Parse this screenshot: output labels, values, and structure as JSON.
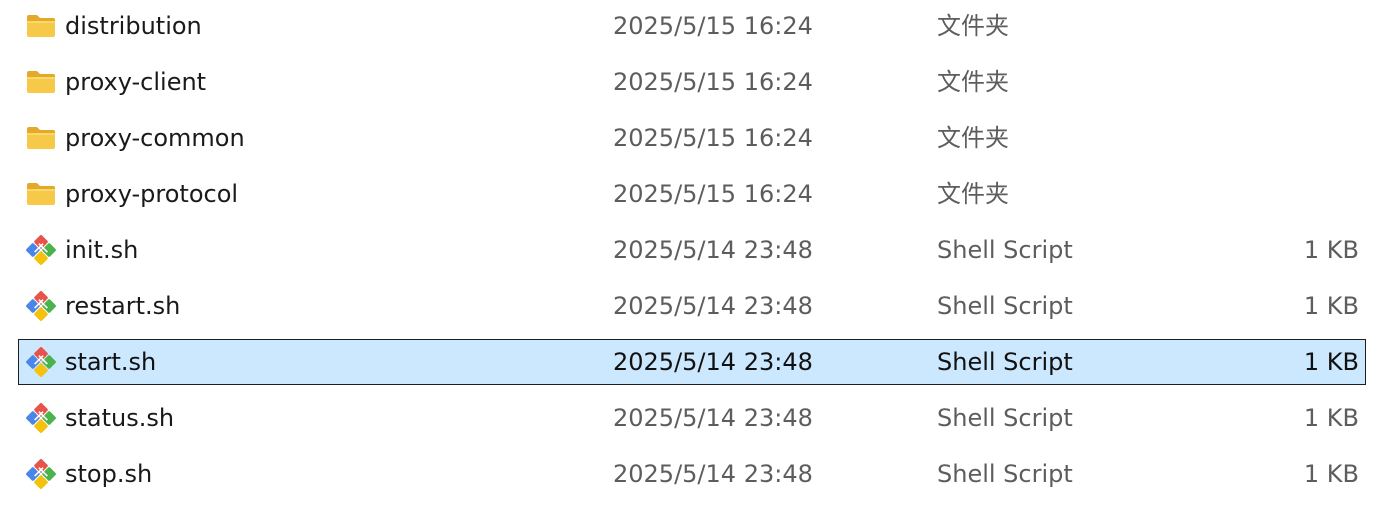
{
  "files": [
    {
      "name": "distribution",
      "date": "2025/5/15 16:24",
      "type": "文件夹",
      "size": "",
      "icon": "folder-icon",
      "selected": false
    },
    {
      "name": "proxy-client",
      "date": "2025/5/15 16:24",
      "type": "文件夹",
      "size": "",
      "icon": "folder-icon",
      "selected": false
    },
    {
      "name": "proxy-common",
      "date": "2025/5/15 16:24",
      "type": "文件夹",
      "size": "",
      "icon": "folder-icon",
      "selected": false
    },
    {
      "name": "proxy-protocol",
      "date": "2025/5/15 16:24",
      "type": "文件夹",
      "size": "",
      "icon": "folder-icon",
      "selected": false
    },
    {
      "name": "init.sh",
      "date": "2025/5/14 23:48",
      "type": "Shell Script",
      "size": "1 KB",
      "icon": "shell-script-icon",
      "selected": false
    },
    {
      "name": "restart.sh",
      "date": "2025/5/14 23:48",
      "type": "Shell Script",
      "size": "1 KB",
      "icon": "shell-script-icon",
      "selected": false
    },
    {
      "name": "start.sh",
      "date": "2025/5/14 23:48",
      "type": "Shell Script",
      "size": "1 KB",
      "icon": "shell-script-icon",
      "selected": true
    },
    {
      "name": "status.sh",
      "date": "2025/5/14 23:48",
      "type": "Shell Script",
      "size": "1 KB",
      "icon": "shell-script-icon",
      "selected": false
    },
    {
      "name": "stop.sh",
      "date": "2025/5/14 23:48",
      "type": "Shell Script",
      "size": "1 KB",
      "icon": "shell-script-icon",
      "selected": false
    }
  ],
  "colors": {
    "selection_background": "#cce8ff",
    "selection_border": "#1f1f1f",
    "folder": "#f7c948",
    "secondary_text": "#5d5d5d"
  }
}
